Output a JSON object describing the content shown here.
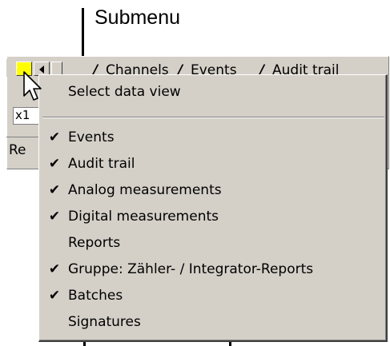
{
  "callout": {
    "label": "Submenu"
  },
  "tabs": [
    {
      "label": "Channels"
    },
    {
      "label": "Events"
    },
    {
      "label": "Audit trail"
    }
  ],
  "background": {
    "field_value": "x1",
    "row_label": "Re"
  },
  "menu": {
    "header": "Select data view",
    "items": [
      {
        "label": "Events",
        "checked": true
      },
      {
        "label": "Audit trail",
        "checked": true
      },
      {
        "label": "Analog measurements",
        "checked": true
      },
      {
        "label": "Digital measurements",
        "checked": true
      },
      {
        "label": "Reports",
        "checked": false
      },
      {
        "label": "Gruppe: Zähler- / Integrator-Reports",
        "checked": true
      },
      {
        "label": "Batches",
        "checked": true
      },
      {
        "label": "Signatures",
        "checked": false
      }
    ],
    "check_glyph": "✔"
  },
  "icons": {
    "cursor": "arrow-cursor-icon",
    "scroll_left": "chevron-left-icon",
    "checkmark": "checkmark-icon"
  },
  "colors": {
    "active_tab_button": "#ffff00",
    "window_face": "#d4d0c8"
  }
}
